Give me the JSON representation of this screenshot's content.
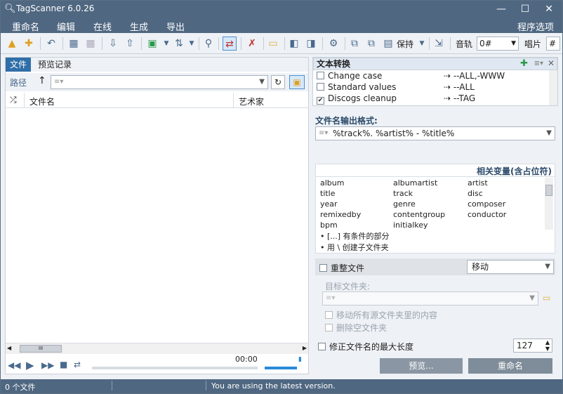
{
  "window": {
    "title": "TagScanner 6.0.26",
    "min": "—",
    "max": "☐",
    "close": "✕"
  },
  "menus": [
    "重命名",
    "编辑",
    "在线",
    "生成",
    "导出"
  ],
  "menu_right": "程序选项",
  "toolbar": {
    "save_label": "保持",
    "track_label": "音轨",
    "track_value": "0#",
    "disc_label": "唱片",
    "disc_value": "#"
  },
  "left": {
    "tabs": [
      "文件",
      "预览记录"
    ],
    "path_label": "路径",
    "path_value": "",
    "columns": [
      "文件名",
      "艺术家"
    ],
    "time": "00:00"
  },
  "right": {
    "text_conv": {
      "title": "文本转换",
      "items": [
        {
          "label": "Change case",
          "checked": false,
          "value": "--ALL,-WWW"
        },
        {
          "label": "Standard values",
          "checked": false,
          "value": "--ALL"
        },
        {
          "label": "Discogs cleanup",
          "checked": true,
          "value": "--TAG"
        }
      ]
    },
    "format_label": "文件名输出格式:",
    "format_value": "%track%. %artist% - %title%",
    "vars_title": "相关变量(含占位符)",
    "vars": [
      "album",
      "albumartist",
      "artist",
      "title",
      "track",
      "disc",
      "year",
      "genre",
      "composer",
      "remixedby",
      "contentgroup",
      "conductor",
      "bpm",
      "initialkey",
      ""
    ],
    "notes": [
      "• [...] 有条件的部分",
      "• 用 \\ 创建子文件夹"
    ],
    "reorg_label": "重整文件",
    "reorg_action": "移动",
    "target_label": "目标文件夹:",
    "opt1": "移动所有源文件夹里的内容",
    "opt2": "删除空文件夹",
    "maxlen_label": "修正文件名的最大长度",
    "maxlen_value": "127",
    "preview_btn": "预览...",
    "rename_btn": "重命名"
  },
  "status": {
    "count": "0 个文件",
    "message": "You are using the latest version."
  }
}
